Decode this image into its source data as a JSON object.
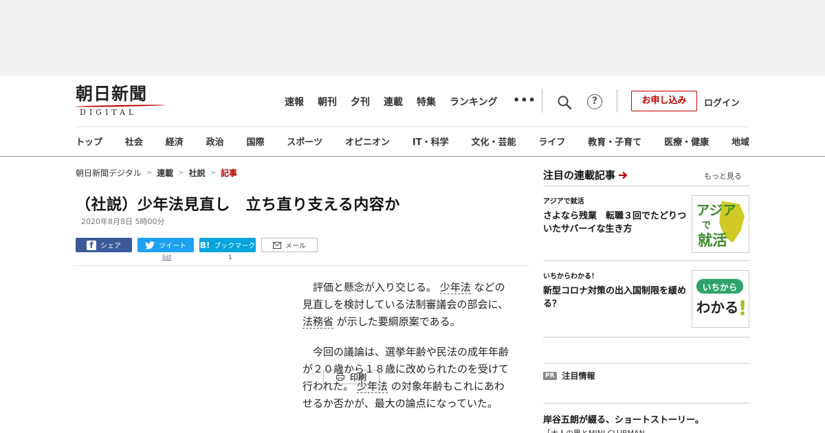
{
  "logo": {
    "ja": "朝日新聞",
    "en": "DIGITAL"
  },
  "topnav": [
    "速報",
    "朝刊",
    "夕刊",
    "連載",
    "特集",
    "ランキング"
  ],
  "header": {
    "more": "•••",
    "subscribe": "お申し込み",
    "login": "ログイン",
    "help": "?"
  },
  "catnav": [
    "トップ",
    "社会",
    "経済",
    "政治",
    "国際",
    "スポーツ",
    "オピニオン",
    "IT・科学",
    "文化・芸能",
    "ライフ",
    "教育・子育て",
    "医療・健康",
    "地域"
  ],
  "breadcrumb": [
    "朝日新聞デジタル",
    "連載",
    "社説",
    "記事"
  ],
  "breadcrumb_sep": ">",
  "article": {
    "title": "（社説）少年法見直し　立ち直り支える内容か",
    "date": "2020年8月8日 5時00分",
    "p1": {
      "a": "評価と懸念が入り交じる。",
      "k1": "少年法",
      "b": "などの見直しを検討している法制審議会の部会に、",
      "k2": "法務省",
      "c": "が示した要綱原案である。"
    },
    "p2": {
      "a": "今回の議論は、選挙年齢や民法の成年年齢が２０歳から１８歳に改められたのを受けて行われた。",
      "k1": "少年法",
      "b": "の対象年齢もこれにあわせるか否かが、最大の論点になっていた。"
    }
  },
  "share": {
    "fb": "シェア",
    "tw": "ツイート",
    "hb": "ブックマーク",
    "mail": "メール",
    "print": "印刷",
    "tw_count": "list",
    "hb_count": "1",
    "hb_icon": "B!"
  },
  "sidebar": {
    "heading": "注目の連載記事",
    "more": "もっと見る",
    "articles": [
      {
        "label": "アジアで就活",
        "title": "さよなら残業　転職３回でたどりついたサバーイな生き方",
        "thumb_lines": [
          "アジア",
          "で",
          "就活"
        ]
      },
      {
        "label": "いちからわかる！",
        "title": "新型コロナ対策の出入国制限を緩める？",
        "thumb_lines": [
          "いちから",
          "わかる",
          "!"
        ]
      }
    ],
    "pr_tag": "PR",
    "pr_label": "注目情報",
    "promo_title": "岸谷五朗が綴る、ショートストーリー。",
    "promo_sub": "「大人の男とMINI CLUBMAN"
  },
  "colors": {
    "brand_red": "#bb0000",
    "facebook": "#3b5998",
    "twitter": "#1da1f2",
    "hatena": "#00a4de"
  }
}
